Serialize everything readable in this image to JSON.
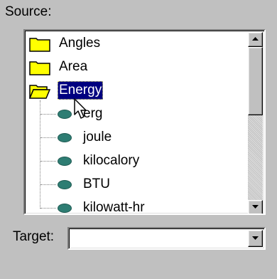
{
  "source": {
    "label": "Source:"
  },
  "tree": {
    "folders": [
      {
        "label": "Angles",
        "icon": "folder-icon",
        "selected": false,
        "expanded": false
      },
      {
        "label": "Area",
        "icon": "folder-icon",
        "selected": false,
        "expanded": false
      },
      {
        "label": "Energy",
        "icon": "open-folder-icon",
        "selected": true,
        "expanded": true
      }
    ],
    "energy_children": [
      {
        "label": "erg",
        "icon": "unit-icon"
      },
      {
        "label": "joule",
        "icon": "unit-icon"
      },
      {
        "label": "kilocalory",
        "icon": "unit-icon"
      },
      {
        "label": "BTU",
        "icon": "unit-icon"
      },
      {
        "label": "kilowatt-hr",
        "icon": "unit-icon"
      }
    ]
  },
  "target": {
    "label": "Target:",
    "value": ""
  },
  "colors": {
    "dialog_bg": "#c0c0c0",
    "selection_bg": "#000080",
    "folder_yellow": "#ffff00",
    "unit_icon": "#2e7d73"
  }
}
